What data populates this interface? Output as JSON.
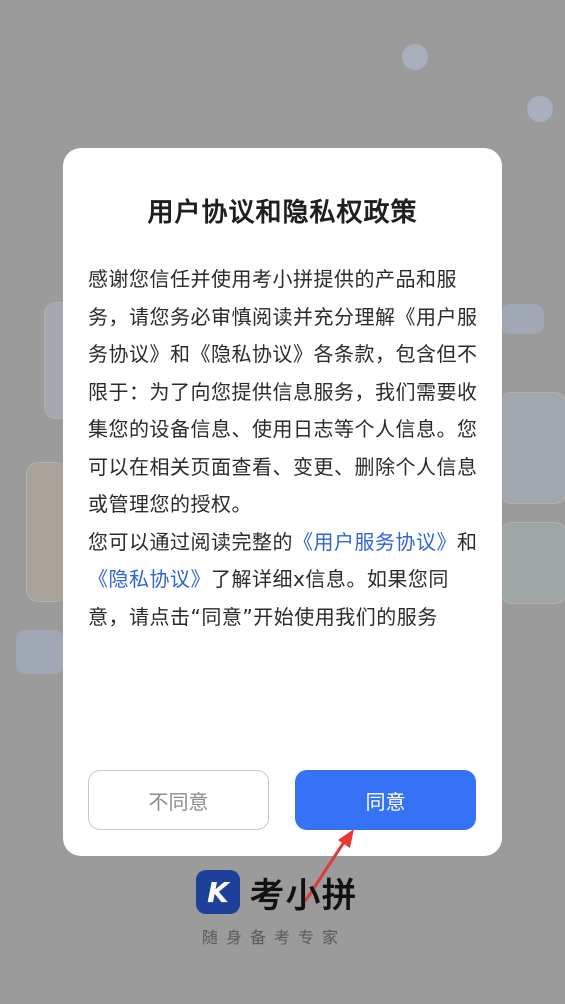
{
  "dialog": {
    "title": "用户协议和隐私权政策",
    "body_p1": "感谢您信任并使用考小拼提供的产品和服务，请您务必审慎阅读并充分理解《用户服务协议》和《隐私协议》各条款，包含但不限于：为了向您提供信息服务，我们需要收集您的设备信息、使用日志等个人信息。您可以在相关页面查看、变更、删除个人信息或管理您的授权。",
    "body_p2_prefix": "您可以通过阅读完整的",
    "link_user_agreement": "《用户服务协议》",
    "body_p2_and": "和",
    "link_privacy": "《隐私协议》",
    "body_p2_suffix": "了解详细x信息。如果您同意，请点击“同意”开始使用我们的服务",
    "disagree_label": "不同意",
    "agree_label": "同意"
  },
  "brand": {
    "logo_letter": "K",
    "name": "考小拼",
    "slogan": "随身备考专家"
  },
  "colors": {
    "overlay": "#9b9b9b",
    "primary": "#3572f6",
    "link": "#2f63d8",
    "arrow": "#e53935"
  }
}
